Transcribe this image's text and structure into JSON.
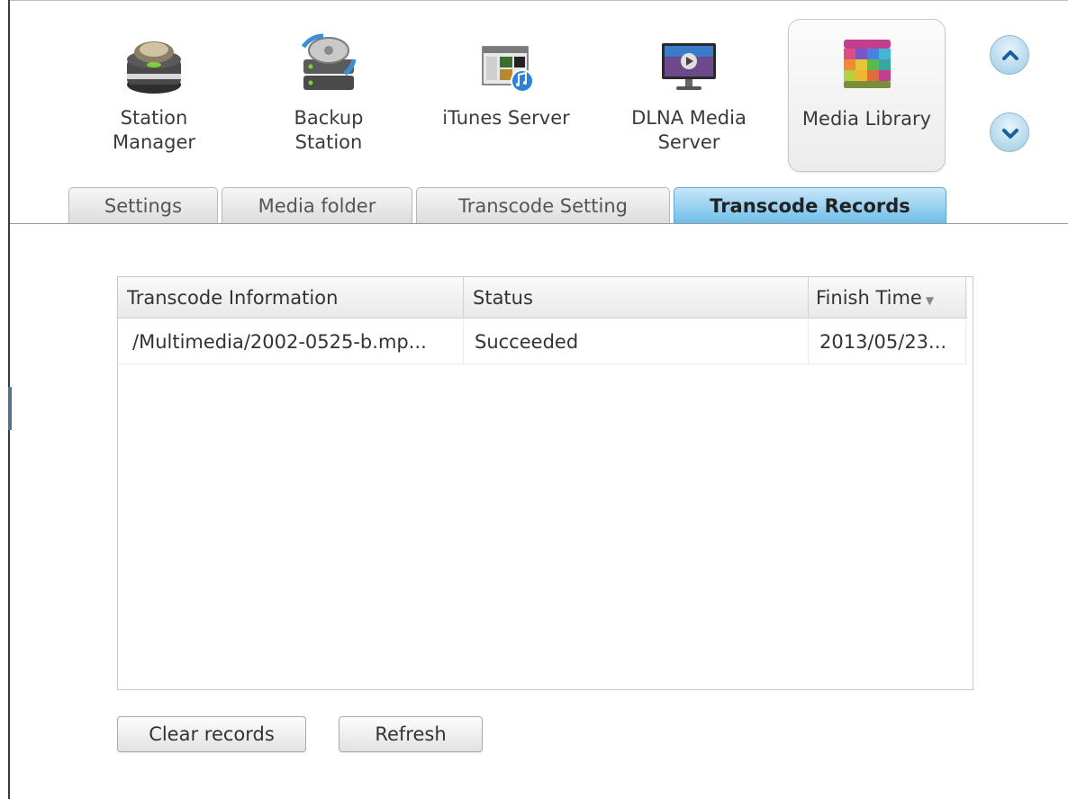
{
  "apps": [
    {
      "name": "Station Manager",
      "line1": "Station",
      "line2": "Manager",
      "icon": "station-manager-icon"
    },
    {
      "name": "Backup Station",
      "line1": "Backup",
      "line2": "Station",
      "icon": "backup-station-icon"
    },
    {
      "name": "iTunes Server",
      "line1": "iTunes Server",
      "line2": "",
      "icon": "itunes-server-icon"
    },
    {
      "name": "DLNA Media Server",
      "line1": "DLNA Media",
      "line2": "Server",
      "icon": "dlna-media-server-icon"
    },
    {
      "name": "Media Library",
      "line1": "Media Library",
      "line2": "",
      "icon": "media-library-icon",
      "selected": true
    }
  ],
  "tabs": [
    {
      "label": "Settings"
    },
    {
      "label": "Media folder"
    },
    {
      "label": "Transcode Setting"
    },
    {
      "label": "Transcode Records",
      "active": true
    }
  ],
  "grid": {
    "columns": [
      "Transcode Information",
      "Status",
      "Finish Time"
    ],
    "rows": [
      {
        "info": "/Multimedia/2002-0525-b.mp...",
        "status": "Succeeded",
        "finish_time": "2013/05/23..."
      }
    ]
  },
  "buttons": {
    "clear": "Clear records",
    "refresh": "Refresh"
  },
  "colors": {
    "active_tab": "#6dbde8",
    "nav_button": "#b9dbee"
  }
}
